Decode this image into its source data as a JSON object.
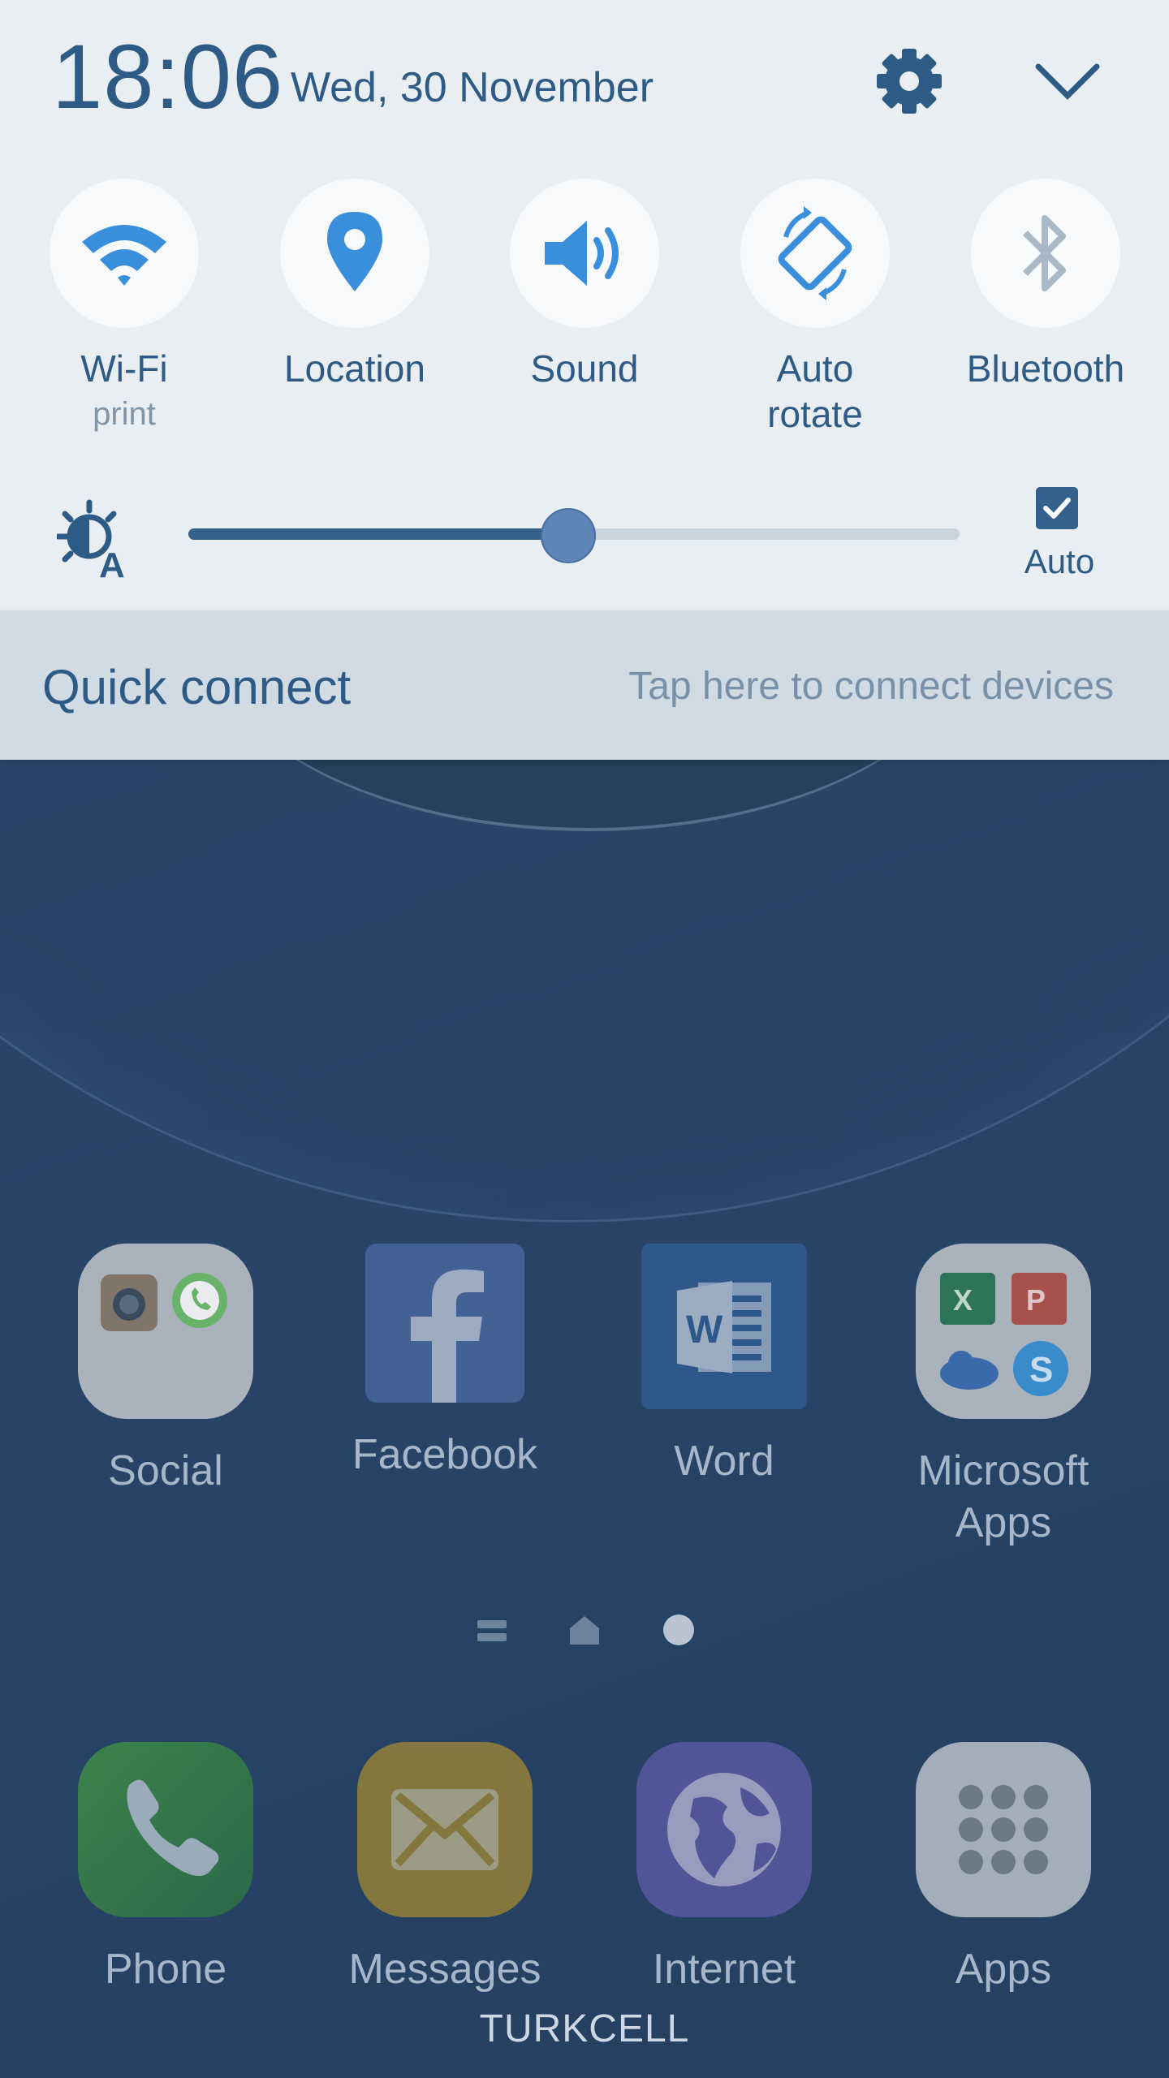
{
  "status": {
    "time": "18:06",
    "date": "Wed, 30 November"
  },
  "quick_settings": [
    {
      "label": "Wi-Fi",
      "sub": "print",
      "icon": "wifi-icon",
      "active": true
    },
    {
      "label": "Location",
      "sub": "",
      "icon": "location-pin-icon",
      "active": true
    },
    {
      "label": "Sound",
      "sub": "",
      "icon": "speaker-icon",
      "active": true
    },
    {
      "label": "Auto\nrotate",
      "sub": "",
      "icon": "auto-rotate-icon",
      "active": true
    },
    {
      "label": "Bluetooth",
      "sub": "",
      "icon": "bluetooth-icon",
      "active": false
    }
  ],
  "brightness": {
    "level_percent": 49,
    "auto_label": "Auto",
    "auto_checked": true
  },
  "quick_connect": {
    "title": "Quick connect",
    "hint": "Tap here to connect devices"
  },
  "home_apps": [
    {
      "label": "Social",
      "icon": "social-folder-icon"
    },
    {
      "label": "Facebook",
      "icon": "facebook-icon"
    },
    {
      "label": "Word",
      "icon": "word-icon"
    },
    {
      "label": "Microsoft\nApps",
      "icon": "microsoft-apps-folder-icon"
    }
  ],
  "dock_apps": [
    {
      "label": "Phone",
      "icon": "phone-icon"
    },
    {
      "label": "Messages",
      "icon": "messages-icon"
    },
    {
      "label": "Internet",
      "icon": "internet-icon"
    },
    {
      "label": "Apps",
      "icon": "apps-grid-icon"
    }
  ],
  "colors": {
    "panel_bg": "#e9eef2",
    "accent": "#2e5b85",
    "icon_active": "#3a8fdc",
    "icon_inactive": "#a9b9c8"
  },
  "carrier": "TURKCELL"
}
